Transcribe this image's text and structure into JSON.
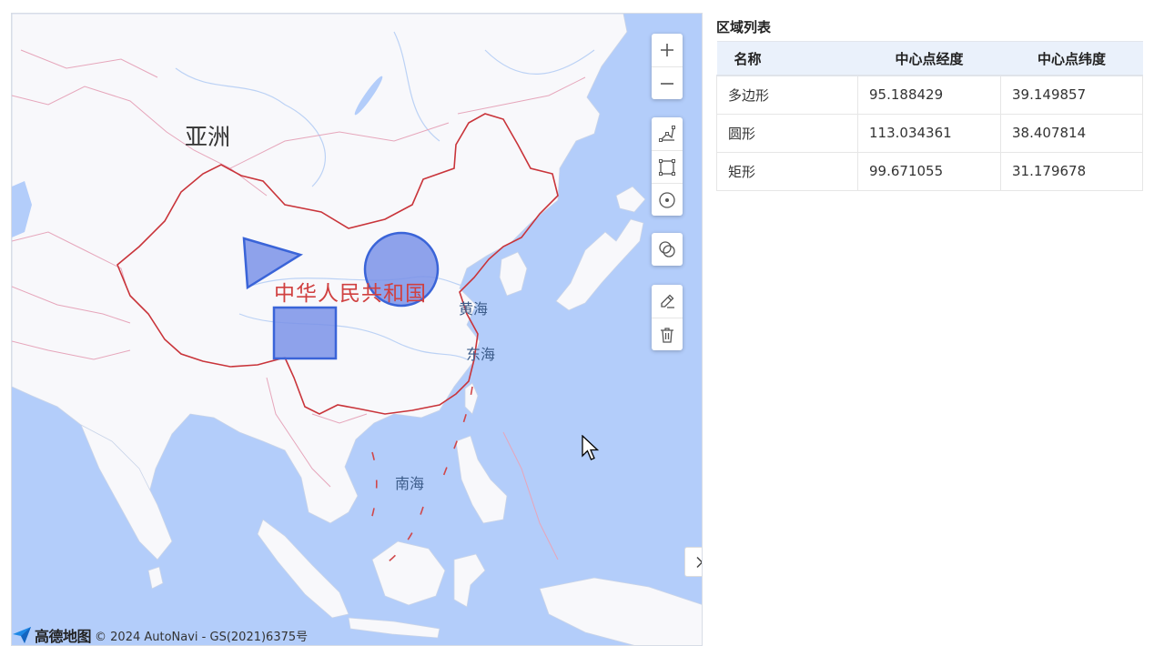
{
  "map": {
    "labels": {
      "continent": "亚洲",
      "country": "中华人民共和国",
      "sea_yellow": "黄海",
      "sea_east": "东海",
      "sea_south": "南海"
    },
    "attribution": {
      "logo_text": "高德地图",
      "copyright": "© 2024 AutoNavi - GS(2021)6375号"
    },
    "toolbar": {
      "zoom_in_icon": "plus-icon",
      "zoom_out_icon": "minus-icon",
      "draw_polygon_icon": "polygon-icon",
      "draw_rectangle_icon": "rectangle-icon",
      "draw_circle_icon": "circle-icon",
      "merge_icon": "merge-circles-icon",
      "edit_icon": "pencil-icon",
      "delete_icon": "trash-icon"
    },
    "collapse_icon": "chevron-right-icon",
    "colors": {
      "ocean": "#b3cdfa",
      "land": "#f8f8fb",
      "shape_fill": "#7b93e8",
      "shape_stroke": "#3a64d8",
      "border_china": "#c9343a"
    }
  },
  "panel": {
    "title": "区域列表",
    "columns": [
      "名称",
      "中心点经度",
      "中心点纬度"
    ],
    "rows": [
      {
        "name": "多边形",
        "lng": "95.188429",
        "lat": "39.149857"
      },
      {
        "name": "圆形",
        "lng": "113.034361",
        "lat": "38.407814"
      },
      {
        "name": "矩形",
        "lng": "99.671055",
        "lat": "31.179678"
      }
    ]
  }
}
